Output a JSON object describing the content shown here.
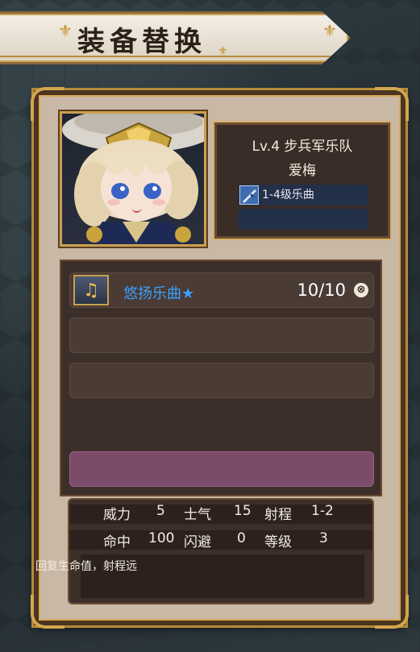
{
  "title": "装备替换",
  "unit": {
    "level_class": "Lv.4  步兵军乐队",
    "name": "爱梅",
    "equipment": "1-4级乐曲",
    "equipment_icon": "rifle-icon"
  },
  "skills": [
    {
      "name": "悠扬乐曲★",
      "count": "10/10",
      "icon": "music-note-icon",
      "remove": "⊗"
    }
  ],
  "stats": {
    "power_label": "威力",
    "power": "5",
    "morale_label": "士气",
    "morale": "15",
    "range_label": "射程",
    "range": "1-2",
    "hit_label": "命中",
    "hit": "100",
    "evade_label": "闪避",
    "evade": "0",
    "grade_label": "等级",
    "grade": "3"
  },
  "description": "回复生命值，射程远",
  "colors": {
    "skill_name": "#3aa1ff",
    "selected_slot": "#7c4b6a",
    "frame_gold": "#d3a64e"
  }
}
